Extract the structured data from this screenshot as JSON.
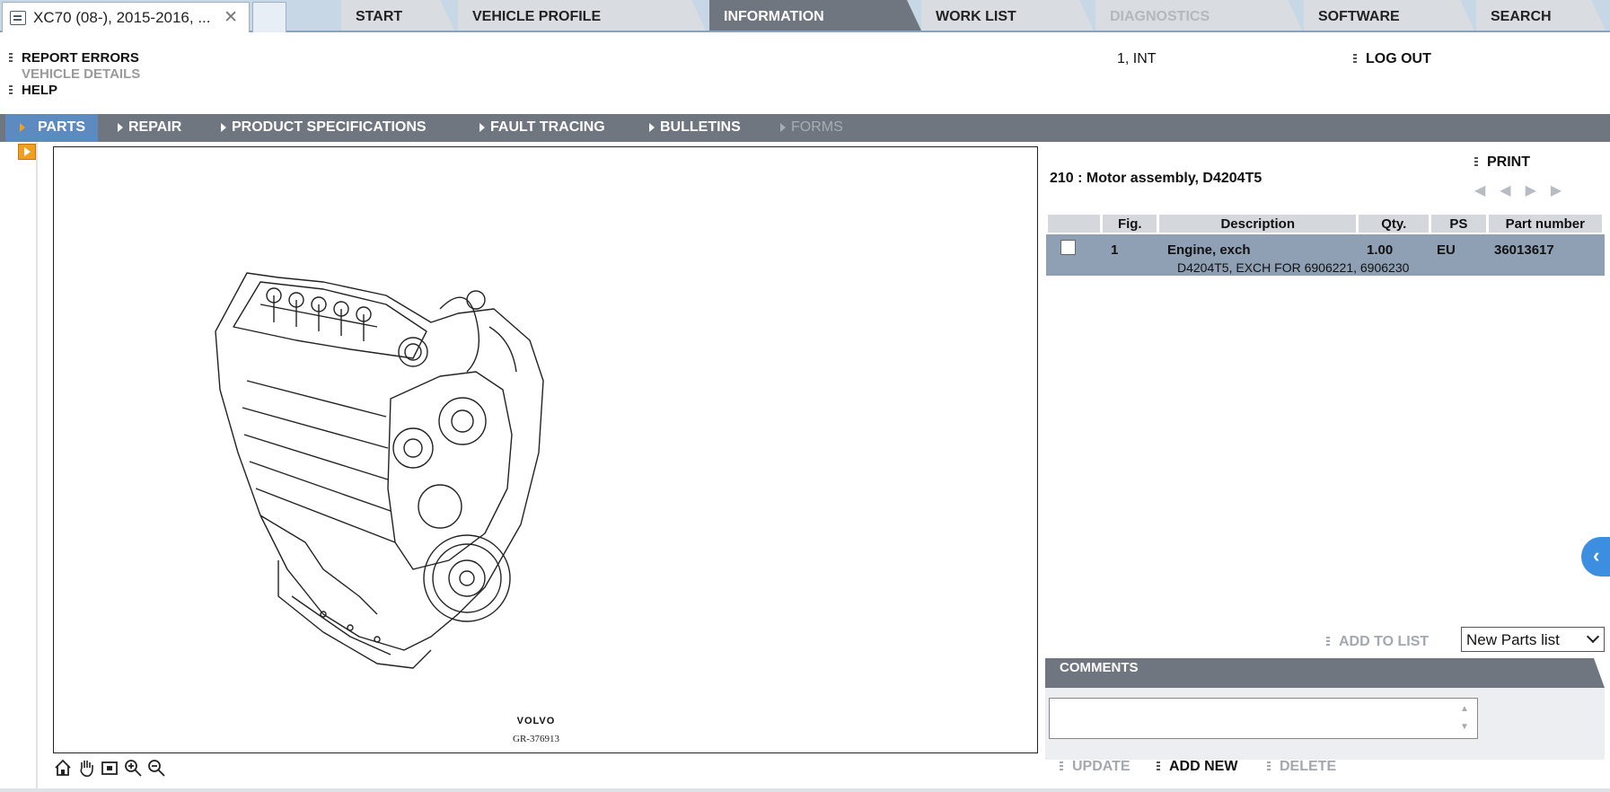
{
  "browser": {
    "tab_title": "XC70 (08-), 2015-2016, ...",
    "close_glyph": "✕"
  },
  "toplinks": {
    "report_errors": "REPORT ERRORS",
    "vehicle_details": "VEHICLE DETAILS",
    "help": "HELP"
  },
  "user": {
    "label": "1, INT",
    "logout": "LOG OUT"
  },
  "tabs": [
    {
      "label": "START",
      "state": "normal"
    },
    {
      "label": "VEHICLE PROFILE",
      "state": "normal"
    },
    {
      "label": "INFORMATION",
      "state": "active"
    },
    {
      "label": "WORK LIST",
      "state": "normal"
    },
    {
      "label": "DIAGNOSTICS",
      "state": "disabled"
    },
    {
      "label": "SOFTWARE",
      "state": "normal"
    },
    {
      "label": "SEARCH",
      "state": "normal"
    }
  ],
  "subnav": [
    {
      "label": "PARTS",
      "state": "active"
    },
    {
      "label": "REPAIR",
      "state": "normal"
    },
    {
      "label": "PRODUCT SPECIFICATIONS",
      "state": "normal"
    },
    {
      "label": "FAULT TRACING",
      "state": "normal"
    },
    {
      "label": "BULLETINS",
      "state": "normal"
    },
    {
      "label": "FORMS",
      "state": "disabled"
    }
  ],
  "drawing": {
    "brand": "VOLVO",
    "figure_id": "GR-376913"
  },
  "panel": {
    "title": "210 : Motor assembly, D4204T5",
    "print": "PRINT",
    "nav_first": "◀◀",
    "nav_next": "▶▶"
  },
  "parts_table": {
    "headers": {
      "fig": "Fig.",
      "description": "Description",
      "qty": "Qty.",
      "ps": "PS",
      "part_number": "Part number"
    },
    "rows": [
      {
        "fig": "1",
        "description": "Engine, exch",
        "qty": "1.00",
        "ps": "EU",
        "part_number": "36013617",
        "note": "D4204T5, EXCH FOR 6906221, 6906230"
      }
    ]
  },
  "list": {
    "add_to_list": "ADD TO LIST",
    "selected": "New Parts list"
  },
  "comments": {
    "title": "COMMENTS",
    "update": "UPDATE",
    "add_new": "ADD NEW",
    "delete": "DELETE"
  },
  "colors": {
    "accent_blue": "#5c8bc2",
    "bar_gray": "#6f7680",
    "row_highlight": "#8fa0b4",
    "orange": "#f0a020"
  }
}
